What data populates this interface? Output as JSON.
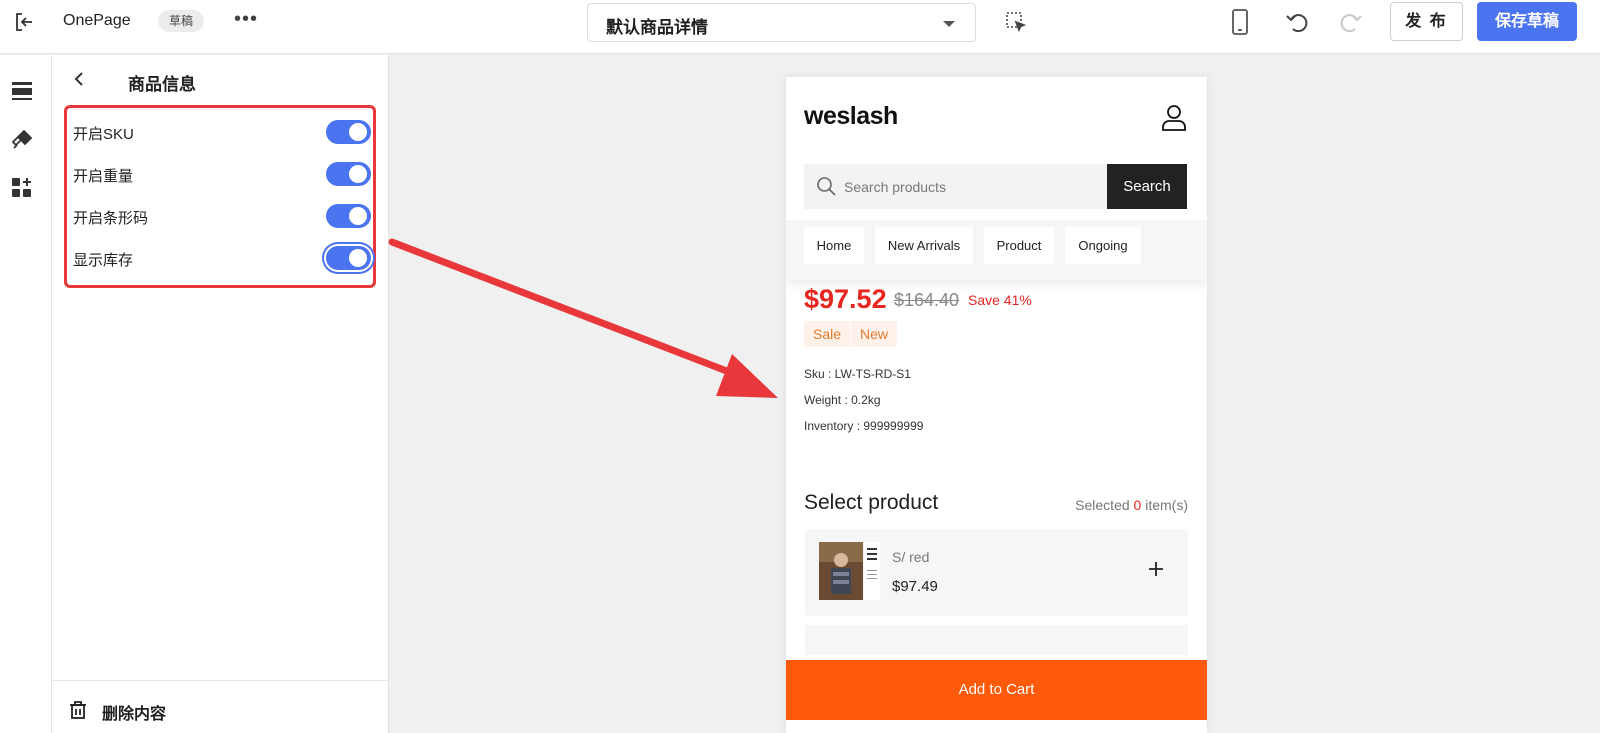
{
  "topbar": {
    "app_name": "OnePage",
    "draft_badge": "草稿",
    "more": "•••",
    "template_select": "默认商品详情",
    "publish_label": "发 布",
    "save_label": "保存草稿"
  },
  "panel": {
    "title": "商品信息",
    "toggles": [
      {
        "label": "开启SKU",
        "on": true
      },
      {
        "label": "开启重量",
        "on": true
      },
      {
        "label": "开启条形码",
        "on": true
      },
      {
        "label": "显示库存",
        "on": true
      }
    ],
    "delete_label": "删除内容"
  },
  "preview": {
    "logo": "weslash",
    "search_placeholder": "Search products",
    "search_button": "Search",
    "nav": [
      "Home",
      "New Arrivals",
      "Product",
      "Ongoing"
    ],
    "price": "$97.52",
    "old_price": "$164.40",
    "save": "Save 41%",
    "tags": [
      "Sale",
      "New"
    ],
    "sku": "Sku : LW-TS-RD-S1",
    "weight": "Weight : 0.2kg",
    "inventory": "Inventory : 999999999",
    "select_title": "Select product",
    "selected_prefix": "Selected",
    "selected_count": "0",
    "selected_suffix": "item(s)",
    "variant": "S/ red",
    "variant_price": "$97.49",
    "add_to_cart": "Add to Cart"
  },
  "colors": {
    "accent": "#4b74f0",
    "highlight": "#e8383b",
    "price_red": "#e8261f",
    "cart_orange": "#ff5a0a"
  }
}
